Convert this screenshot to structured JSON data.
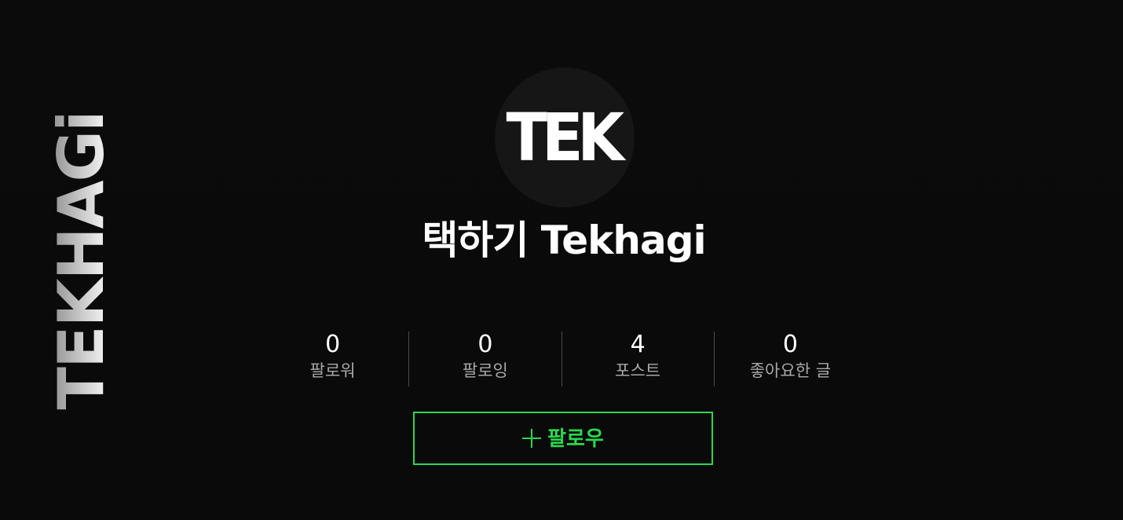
{
  "sidebar": {
    "brand_text": "TEKHAGi"
  },
  "profile": {
    "avatar_text": "TEK",
    "name": "택하기 Tekhagi"
  },
  "stats": [
    {
      "value": "0",
      "label": "팔로워"
    },
    {
      "value": "0",
      "label": "팔로잉"
    },
    {
      "value": "4",
      "label": "포스트"
    },
    {
      "value": "0",
      "label": "좋아요한 글"
    }
  ],
  "actions": {
    "follow_icon": "plus-icon",
    "follow_label": "팔로우"
  },
  "colors": {
    "background": "#0b0b0b",
    "accent": "#2bd64f",
    "muted_text": "#a8a8a8",
    "divider": "#4a4a4a",
    "avatar_bg": "#161616"
  }
}
